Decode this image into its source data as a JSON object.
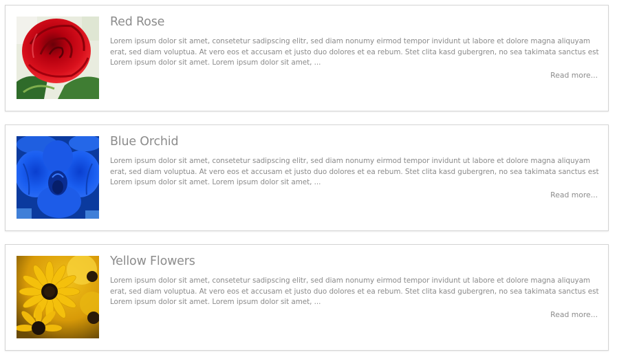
{
  "articles": [
    {
      "title": "Red Rose",
      "image": "red-rose-photo",
      "excerpt": "Lorem ipsum dolor sit amet, consetetur sadipscing elitr, sed diam nonumy eirmod tempor invidunt ut labore et dolore magna aliquyam erat, sed diam voluptua. At vero eos et accusam et justo duo dolores et ea rebum. Stet clita kasd gubergren, no sea takimata sanctus est Lorem ipsum dolor sit amet. Lorem ipsum dolor sit amet, ...",
      "read_more": "Read more..."
    },
    {
      "title": "Blue Orchid",
      "image": "blue-orchid-photo",
      "excerpt": "Lorem ipsum dolor sit amet, consetetur sadipscing elitr, sed diam nonumy eirmod tempor invidunt ut labore et dolore magna aliquyam erat, sed diam voluptua. At vero eos et accusam et justo duo dolores et ea rebum. Stet clita kasd gubergren, no sea takimata sanctus est Lorem ipsum dolor sit amet. Lorem ipsum dolor sit amet, ...",
      "read_more": "Read more..."
    },
    {
      "title": "Yellow Flowers",
      "image": "yellow-flowers-photo",
      "excerpt": "Lorem ipsum dolor sit amet, consetetur sadipscing elitr, sed diam nonumy eirmod tempor invidunt ut labore et dolore magna aliquyam erat, sed diam voluptua. At vero eos et accusam et justo duo dolores et ea rebum. Stet clita kasd gubergren, no sea takimata sanctus est Lorem ipsum dolor sit amet. Lorem ipsum dolor sit amet, ...",
      "read_more": "Read more..."
    }
  ],
  "colors": {
    "text": "#8a8a8a",
    "border": "#d4d4d4",
    "background": "#ffffff"
  }
}
